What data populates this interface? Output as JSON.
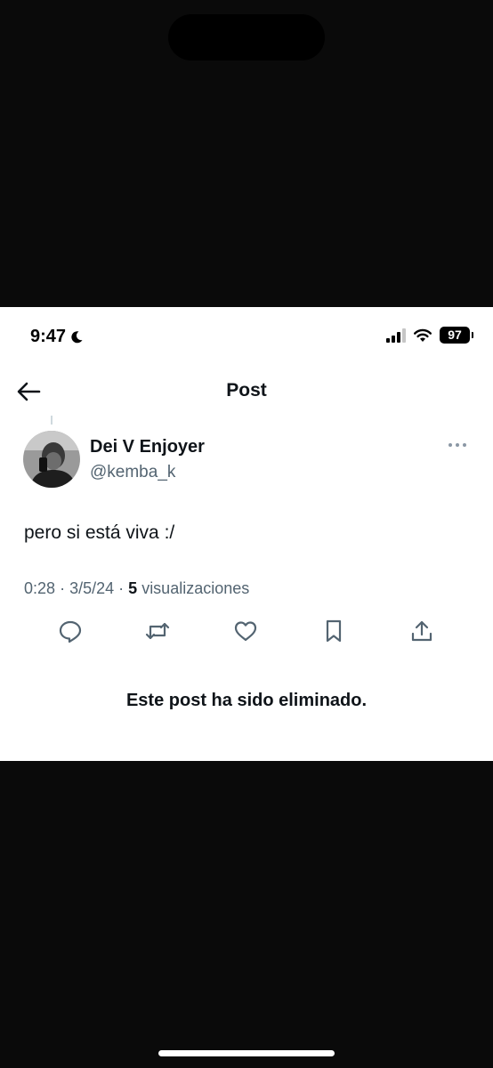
{
  "status_bar": {
    "time": "9:47",
    "battery": "97",
    "icons": [
      "moon-icon",
      "signal-icon",
      "wifi-icon",
      "battery-icon"
    ]
  },
  "header": {
    "title": "Post",
    "back_icon": "arrow-left-icon"
  },
  "post": {
    "author_name": "Dei V Enjoyer",
    "author_handle": "@kemba_k",
    "text": "pero si está viva :/",
    "time": "0:28",
    "date": "3/5/24",
    "views_count": "5",
    "views_label": "visualizaciones",
    "separator": "·"
  },
  "actions": [
    "reply-icon",
    "repost-icon",
    "like-icon",
    "bookmark-icon",
    "share-icon"
  ],
  "deleted_message": "Este post ha sido eliminado.",
  "colors": {
    "text_primary": "#0f1419",
    "text_secondary": "#536471",
    "background": "#ffffff",
    "outer_background": "#0a0a0a"
  }
}
